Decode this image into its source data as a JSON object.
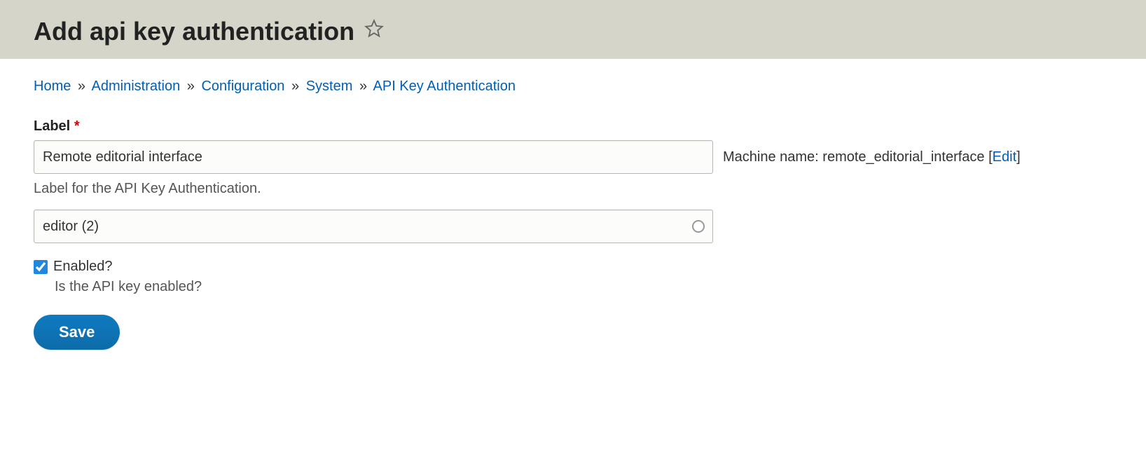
{
  "header": {
    "title": "Add api key authentication"
  },
  "breadcrumb": {
    "items": [
      {
        "label": "Home"
      },
      {
        "label": "Administration"
      },
      {
        "label": "Configuration"
      },
      {
        "label": "System"
      },
      {
        "label": "API Key Authentication"
      }
    ],
    "separator": "»"
  },
  "form": {
    "label_field": {
      "label": "Label",
      "required": "*",
      "value": "Remote editorial interface",
      "description": "Label for the API Key Authentication."
    },
    "machine_name": {
      "prefix": "Machine name: ",
      "value": "remote_editorial_interface",
      "edit_label": "Edit"
    },
    "user_select": {
      "value": "editor (2)"
    },
    "enabled_checkbox": {
      "label": "Enabled?",
      "checked": true,
      "description": "Is the API key enabled?"
    },
    "save_button": "Save"
  }
}
